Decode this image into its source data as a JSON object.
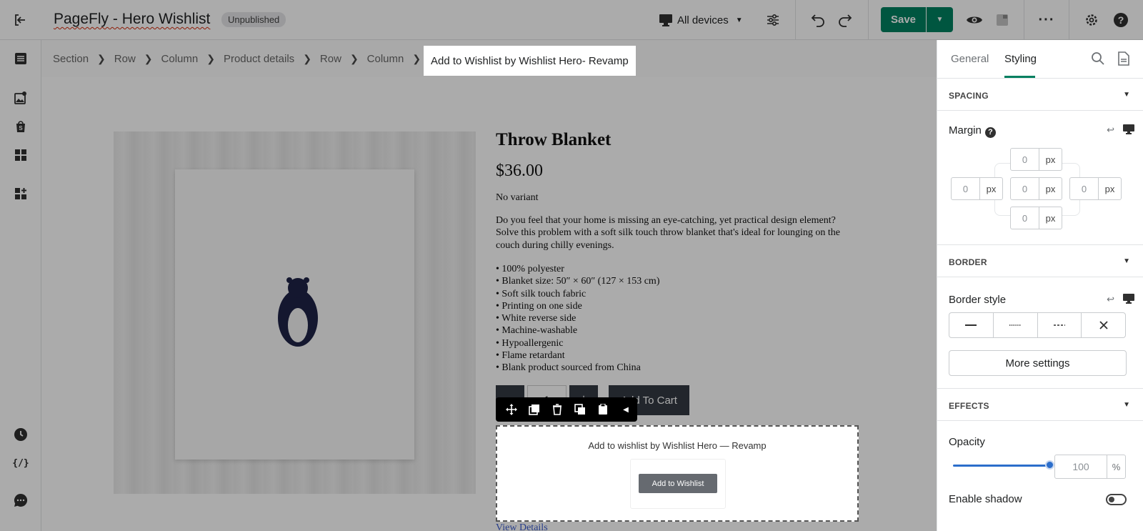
{
  "topbar": {
    "title_main": "PageFly",
    "title_rest": " - Hero Wishlist",
    "status_badge": "Unpublished",
    "device_label": "All devices",
    "save_label": "Save"
  },
  "breadcrumb": {
    "items": [
      "Section",
      "Row",
      "Column",
      "Product details",
      "Row",
      "Column"
    ],
    "active": "Add to Wishlist by Wishlist Hero- Revamp"
  },
  "product": {
    "title": "Throw Blanket",
    "price": "$36.00",
    "variant": "No variant",
    "description": "Do you feel that your home is missing an eye-catching, yet practical design element? Solve this problem with a soft silk touch throw blanket that's ideal for lounging on the couch during chilly evenings.",
    "bullets": [
      "• 100% polyester",
      "• Blanket size: 50″ × 60″ (127 × 153 cm)",
      "• Soft silk touch fabric",
      "• Printing on one side",
      "• White reverse side",
      "• Machine-washable",
      "• Hypoallergenic",
      "• Flame retardant",
      "• Blank product sourced from China"
    ],
    "qty_minus": "−",
    "qty_value": "1",
    "qty_plus": "+",
    "add_to_cart": "Add To Cart",
    "view_details": "View Details"
  },
  "wishlist": {
    "title": "Add to wishlist by Wishlist Hero — Revamp",
    "button": "Add to Wishlist"
  },
  "panel": {
    "tab_general": "General",
    "tab_styling": "Styling",
    "spacing_head": "SPACING",
    "margin_label": "Margin",
    "margin_help": "?",
    "margin": {
      "top": "0",
      "left": "0",
      "center": "0",
      "right": "0",
      "bottom": "0",
      "unit": "px"
    },
    "border_head": "BORDER",
    "border_style_label": "Border style",
    "more_settings": "More settings",
    "effects_head": "EFFECTS",
    "opacity_label": "Opacity",
    "opacity_value": "100",
    "opacity_unit": "%",
    "opacity_level": 1.0,
    "enable_shadow": "Enable shadow",
    "enable_shadow_on": false
  },
  "colors": {
    "save_green": "#008060",
    "accent_blue": "#2c6ecb",
    "dark_button": "#333a42"
  }
}
